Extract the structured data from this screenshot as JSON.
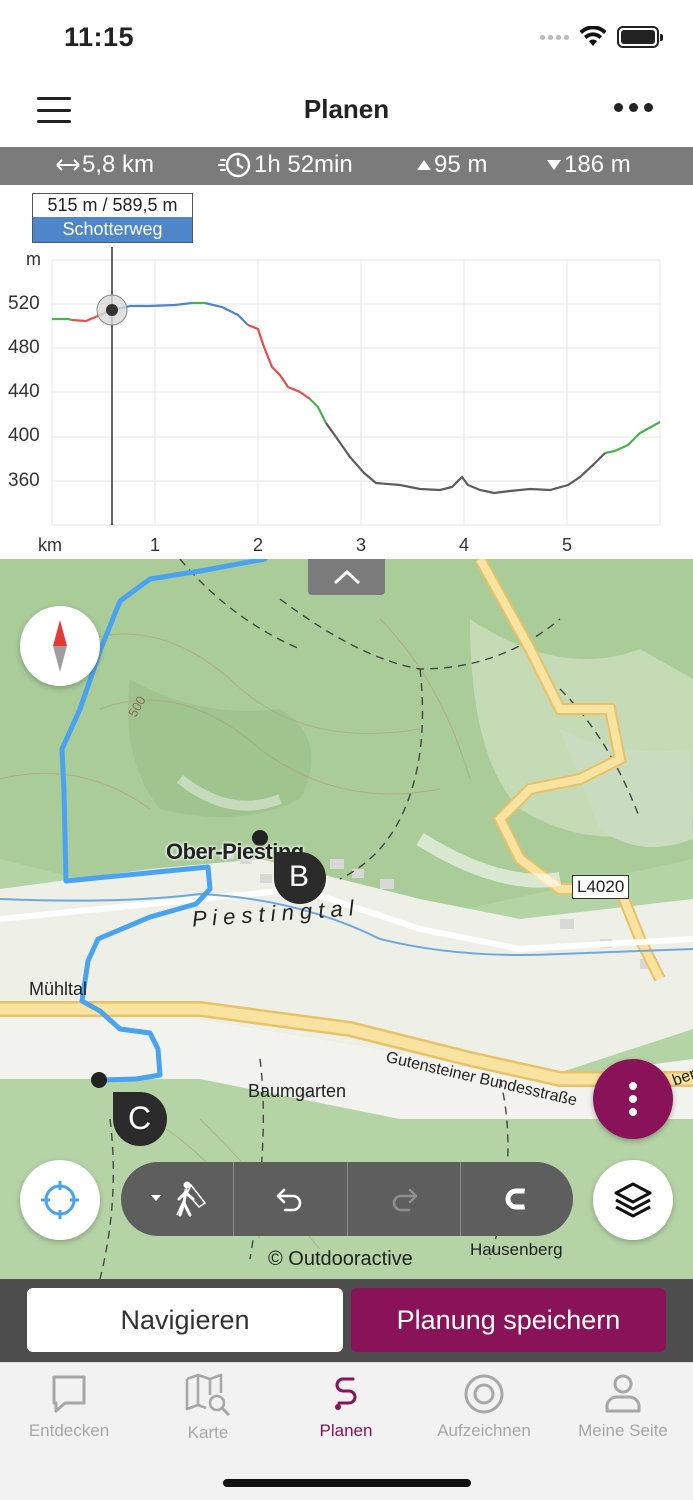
{
  "status": {
    "time": "11:15"
  },
  "nav": {
    "title": "Planen"
  },
  "stats": {
    "distance": "5,8 km",
    "duration": "1h 52min",
    "ascent": "95 m",
    "descent": "186 m"
  },
  "profile": {
    "tooltip_value": "515 m / 589,5 m",
    "tooltip_surface": "Schotterweg",
    "y_unit": "m",
    "x_unit": "km",
    "y_ticks": [
      "520",
      "480",
      "440",
      "400",
      "360"
    ],
    "x_ticks": [
      "1",
      "2",
      "3",
      "4",
      "5"
    ]
  },
  "map": {
    "places": {
      "ober_piesting": "Ober-Piesting",
      "piestingtal": "P i e s t i n g t a l",
      "muehltal": "Mühltal",
      "baumgarten": "Baumgarten",
      "hausenberg": "Hausenberg",
      "road_l4020": "L4020",
      "bundesstrasse": "Gutensteiner Bundesstraße",
      "bundesstrasse_cut": "ber Bu",
      "contour_500": "500"
    },
    "waypoints": {
      "b": "B",
      "c": "C"
    },
    "copyright": "© Outdooractive"
  },
  "actions": {
    "navigate": "Navigieren",
    "save": "Planung speichern"
  },
  "tabs": [
    {
      "label": "Entdecken",
      "icon": "chat-bubble-icon"
    },
    {
      "label": "Karte",
      "icon": "map-search-icon"
    },
    {
      "label": "Planen",
      "icon": "route-s-icon"
    },
    {
      "label": "Aufzeichnen",
      "icon": "record-icon"
    },
    {
      "label": "Meine Seite",
      "icon": "person-icon"
    }
  ],
  "colors": {
    "accent": "#8a1258",
    "route": "#4aa3f0",
    "stats_bar": "#7b7b7b",
    "map_bg": "#b9d6ad"
  }
}
